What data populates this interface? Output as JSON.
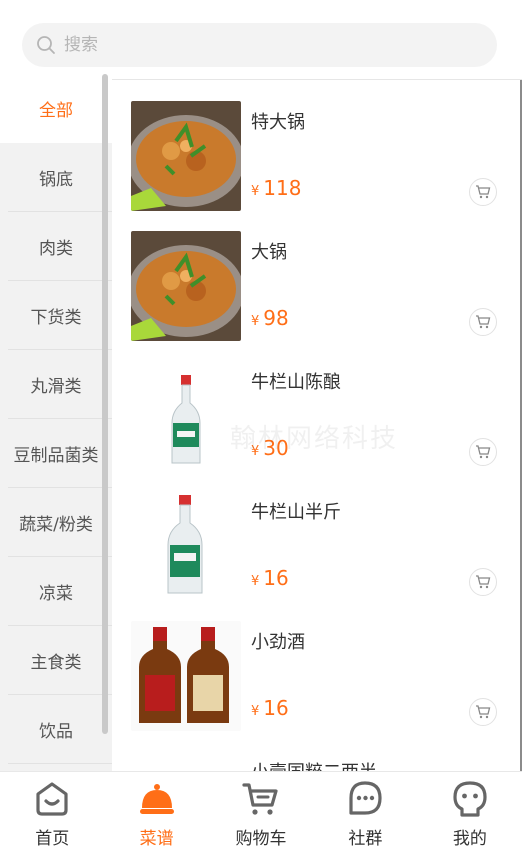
{
  "search": {
    "placeholder": "搜索",
    "value": ""
  },
  "categories": [
    {
      "label": "全部",
      "active": true
    },
    {
      "label": "锅底"
    },
    {
      "label": "肉类"
    },
    {
      "label": "下货类"
    },
    {
      "label": "丸滑类"
    },
    {
      "label": "豆制品菌类"
    },
    {
      "label": "蔬菜/粉类"
    },
    {
      "label": "凉菜"
    },
    {
      "label": "主食类"
    },
    {
      "label": "饮品"
    }
  ],
  "currency": "¥",
  "products": [
    {
      "name": "特大锅",
      "price": "118",
      "image": "dry-pot-dish"
    },
    {
      "name": "大锅",
      "price": "98",
      "image": "dry-pot-dish"
    },
    {
      "name": "牛栏山陈酿",
      "price": "30",
      "image": "baijiu-bottle"
    },
    {
      "name": "牛栏山半斤",
      "price": "16",
      "image": "baijiu-bottle"
    },
    {
      "name": "小劲酒",
      "price": "16",
      "image": "jinjiu-bottles"
    },
    {
      "name": "小壹国粹二两半",
      "price": "",
      "image": ""
    }
  ],
  "watermark": "翰林网络科技",
  "tabs": [
    {
      "label": "首页",
      "icon": "home-icon"
    },
    {
      "label": "菜谱",
      "icon": "menu-cloche-icon",
      "active": true
    },
    {
      "label": "购物车",
      "icon": "cart-icon"
    },
    {
      "label": "社群",
      "icon": "chat-icon"
    },
    {
      "label": "我的",
      "icon": "profile-icon"
    }
  ],
  "colors": {
    "accent": "#ff6e17",
    "sidebar_bg": "#f2f2f2",
    "search_bg": "#f3f3f3"
  }
}
